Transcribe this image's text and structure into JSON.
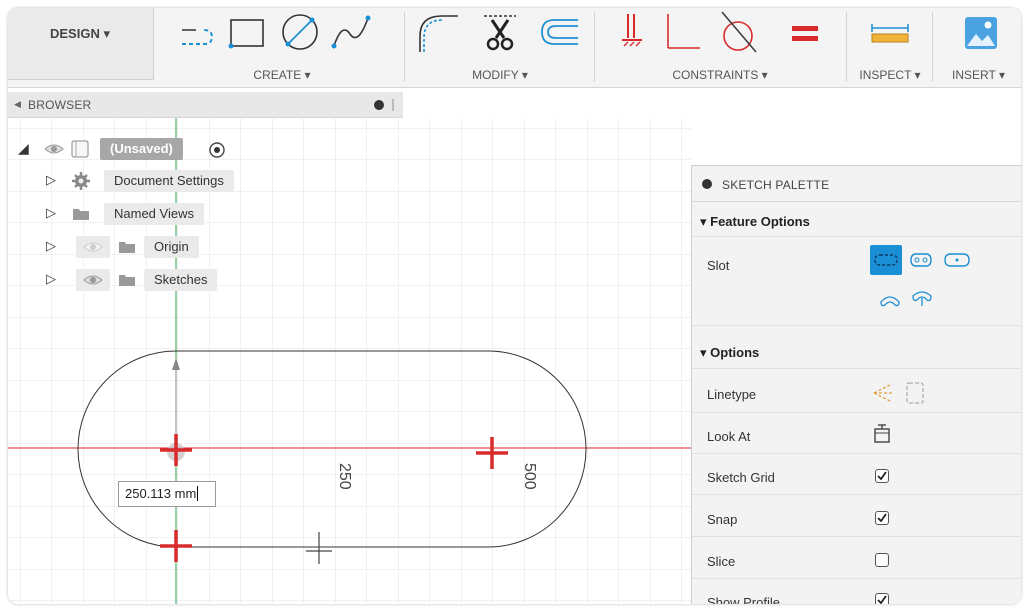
{
  "toolbar": {
    "design_label": "DESIGN",
    "groups": [
      {
        "label": "CREATE"
      },
      {
        "label": "MODIFY"
      },
      {
        "label": "CONSTRAINTS"
      },
      {
        "label": "INSPECT"
      },
      {
        "label": "INSERT"
      }
    ]
  },
  "browser": {
    "title": "BROWSER",
    "root_label": "(Unsaved)",
    "items": [
      {
        "label": "Document Settings"
      },
      {
        "label": "Named Views"
      },
      {
        "label": "Origin"
      },
      {
        "label": "Sketches"
      }
    ]
  },
  "canvas": {
    "dimension_250": "250",
    "dimension_500": "500",
    "input_value": "250.113 mm"
  },
  "palette": {
    "title": "SKETCH PALETTE",
    "feature_options_label": "Feature Options",
    "slot_label": "Slot",
    "options_label": "Options",
    "rows": [
      {
        "label": "Linetype"
      },
      {
        "label": "Look At"
      },
      {
        "label": "Sketch Grid",
        "checked": true
      },
      {
        "label": "Snap",
        "checked": true
      },
      {
        "label": "Slice",
        "checked": false
      },
      {
        "label": "Show Profile",
        "checked": true
      }
    ]
  },
  "colors": {
    "accent_blue": "#1b8fd6",
    "axis_red": "#e02020",
    "axis_green": "#2fa04a",
    "constraint_red": "#d92b2b"
  },
  "icons": [
    "arc-slot-icon",
    "rectangle-icon",
    "circle-icon",
    "spline-icon",
    "fillet-icon",
    "trim-icon",
    "offset-icon",
    "coincident-icon",
    "perpendicular-icon",
    "tangent-icon",
    "equal-icon",
    "measure-icon",
    "insert-image-icon"
  ]
}
